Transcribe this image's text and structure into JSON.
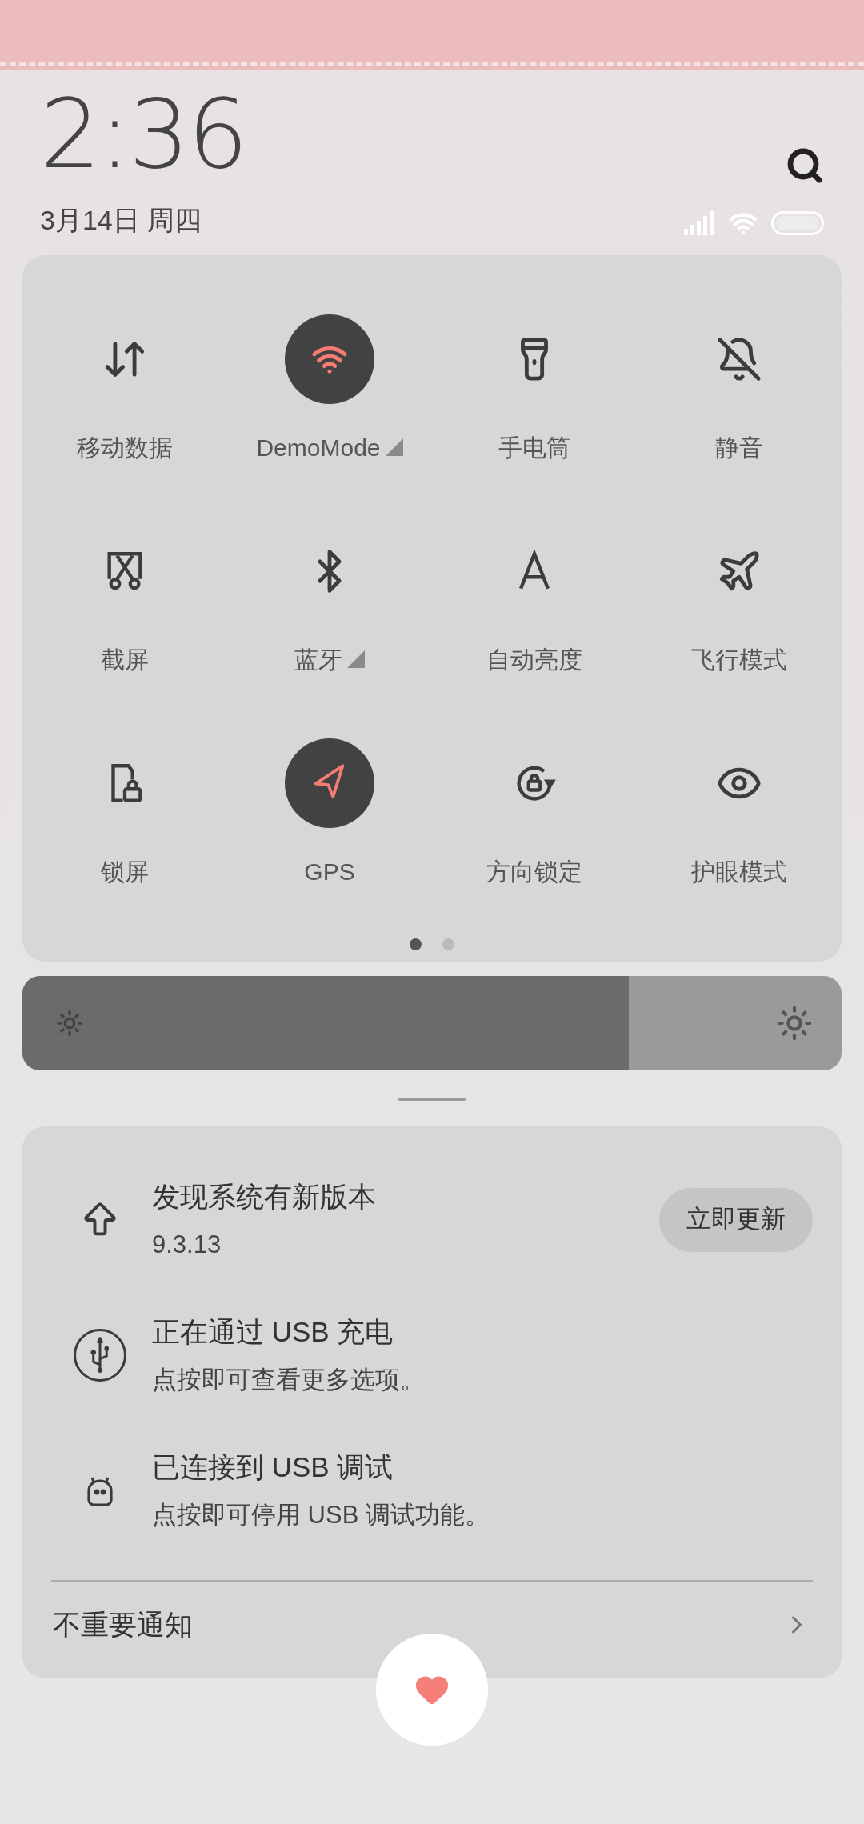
{
  "header": {
    "time": "2:36",
    "date": "3月14日 周四"
  },
  "tiles": [
    {
      "label": "移动数据",
      "kind": "mobile-data",
      "on": false,
      "expandable": false
    },
    {
      "label": "DemoMode",
      "kind": "wifi",
      "on": true,
      "expandable": true
    },
    {
      "label": "手电筒",
      "kind": "flashlight",
      "on": false,
      "expandable": false
    },
    {
      "label": "静音",
      "kind": "mute",
      "on": false,
      "expandable": false
    },
    {
      "label": "截屏",
      "kind": "screenshot",
      "on": false,
      "expandable": false
    },
    {
      "label": "蓝牙",
      "kind": "bluetooth",
      "on": false,
      "expandable": true
    },
    {
      "label": "自动亮度",
      "kind": "brightness",
      "on": false,
      "expandable": false
    },
    {
      "label": "飞行模式",
      "kind": "airplane",
      "on": false,
      "expandable": false
    },
    {
      "label": "锁屏",
      "kind": "lock",
      "on": false,
      "expandable": false
    },
    {
      "label": "GPS",
      "kind": "gps",
      "on": true,
      "expandable": false
    },
    {
      "label": "方向锁定",
      "kind": "rotation",
      "on": false,
      "expandable": false
    },
    {
      "label": "护眼模式",
      "kind": "eye",
      "on": false,
      "expandable": false
    }
  ],
  "pager": [
    {
      "selected": true
    },
    {
      "selected": false
    }
  ],
  "brightness": {
    "level": 0.74
  },
  "notifications": [
    {
      "kind": "update",
      "title": "发现系统有新版本",
      "subtitle": "9.3.13",
      "action": "立即更新"
    },
    {
      "kind": "usb",
      "title": "正在通过 USB 充电",
      "subtitle": "点按即可查看更多选项。"
    },
    {
      "kind": "debug",
      "title": "已连接到 USB 调试",
      "subtitle": "点按即可停用 USB 调试功能。"
    }
  ],
  "footer": {
    "label": "不重要通知"
  }
}
